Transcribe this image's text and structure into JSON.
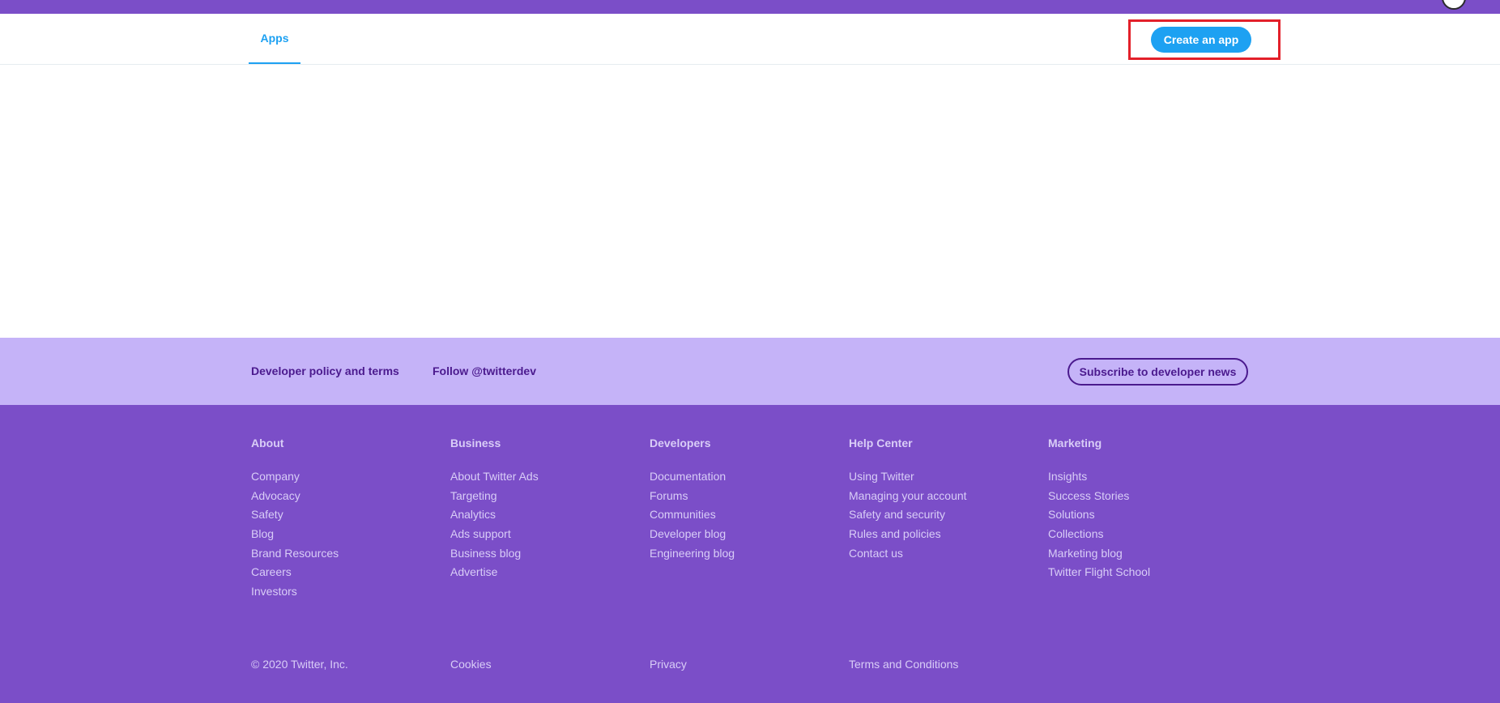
{
  "header": {
    "tabs": [
      {
        "label": "Apps"
      }
    ],
    "create_app_label": "Create an app"
  },
  "band": {
    "policy_link": "Developer policy and terms",
    "follow_link": "Follow @twitterdev",
    "subscribe_label": "Subscribe to developer news"
  },
  "footer": {
    "columns": [
      {
        "heading": "About",
        "links": [
          "Company",
          "Advocacy",
          "Safety",
          "Blog",
          "Brand Resources",
          "Careers",
          "Investors"
        ]
      },
      {
        "heading": "Business",
        "links": [
          "About Twitter Ads",
          "Targeting",
          "Analytics",
          "Ads support",
          "Business blog",
          "Advertise"
        ]
      },
      {
        "heading": "Developers",
        "links": [
          "Documentation",
          "Forums",
          "Communities",
          "Developer blog",
          "Engineering blog"
        ]
      },
      {
        "heading": "Help Center",
        "links": [
          "Using Twitter",
          "Managing your account",
          "Safety and security",
          "Rules and policies",
          "Contact us"
        ]
      },
      {
        "heading": "Marketing",
        "links": [
          "Insights",
          "Success Stories",
          "Solutions",
          "Collections",
          "Marketing blog",
          "Twitter Flight School"
        ]
      }
    ],
    "legal": {
      "copyright": "© 2020 Twitter, Inc.",
      "cookies": "Cookies",
      "privacy": "Privacy",
      "terms": "Terms and Conditions"
    }
  },
  "colors": {
    "brand_purple": "#7b4ec8",
    "band_lavender": "#c5b3f8",
    "accent_blue": "#1da1f2",
    "highlight_red": "#e3202a"
  }
}
